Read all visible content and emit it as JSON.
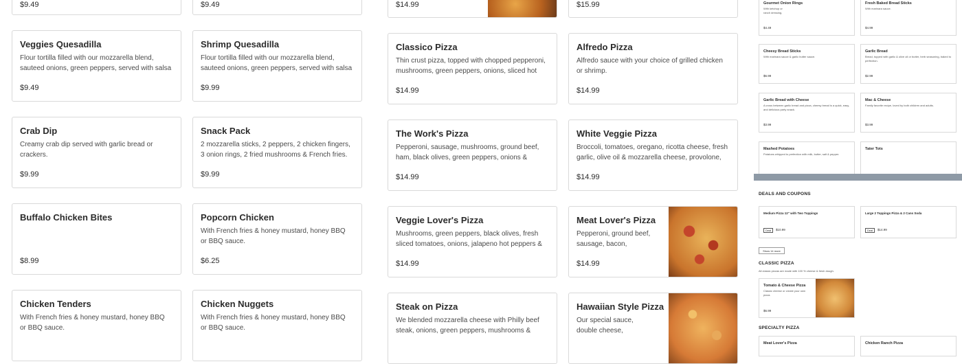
{
  "menu": {
    "top_prices": [
      "$9.49",
      "$9.49",
      "$14.99",
      "$15.99"
    ],
    "col1": [
      {
        "name": "Veggies Quesadilla",
        "desc": "Flour tortilla filled with our mozzarella blend, sauteed onions, green peppers, served with salsa",
        "price": "$9.49"
      },
      {
        "name": "Crab Dip",
        "desc": "Creamy crab dip served with garlic bread or crackers.",
        "price": "$9.99"
      },
      {
        "name": "Buffalo Chicken Bites",
        "desc": "",
        "price": "$8.99"
      },
      {
        "name": "Chicken Tenders",
        "desc": "With French fries & honey mustard, honey BBQ or BBQ sauce.",
        "price": ""
      }
    ],
    "col2": [
      {
        "name": "Shrimp Quesadilla",
        "desc": "Flour tortilla filled with our mozzarella blend, sauteed onions, green peppers, served with salsa",
        "price": "$9.99"
      },
      {
        "name": "Snack Pack",
        "desc": "2 mozzarella sticks, 2 peppers, 2 chicken fingers, 3 onion rings, 2 fried mushrooms & French fries.",
        "price": "$9.99"
      },
      {
        "name": "Popcorn Chicken",
        "desc": "With French fries & honey mustard, honey BBQ or BBQ sauce.",
        "price": "$6.25"
      },
      {
        "name": "Chicken Nuggets",
        "desc": "With French fries & honey mustard, honey BBQ or BBQ sauce.",
        "price": ""
      }
    ],
    "col3": [
      {
        "name": "Classico Pizza",
        "desc": "Thin crust pizza, topped with chopped pepperoni, mushrooms, green peppers, onions, sliced hot",
        "price": "$14.99"
      },
      {
        "name": "The Work's Pizza",
        "desc": "Pepperoni, sausage, mushrooms, ground beef, ham, black olives, green peppers, onions & double",
        "price": "$14.99"
      },
      {
        "name": "Veggie Lover's Pizza",
        "desc": "Mushrooms, green peppers, black olives, fresh sliced tomatoes, onions, jalapeno hot peppers &",
        "price": "$14.99"
      },
      {
        "name": "Steak on Pizza",
        "desc": "We blended mozzarella cheese with Philly beef steak, onions, green peppers, mushrooms &",
        "price": ""
      }
    ],
    "col4": [
      {
        "name": "Alfredo Pizza",
        "desc": "Alfredo sauce with your choice of grilled chicken or shrimp.",
        "price": "$14.99"
      },
      {
        "name": "White Veggie Pizza",
        "desc": "Broccoli, tomatoes, oregano, ricotta cheese, fresh garlic, olive oil & mozzarella cheese, provolone,",
        "price": "$14.99"
      },
      {
        "name": "Meat Lover's Pizza",
        "desc": "Pepperoni, ground beef, sausage, bacon, imported",
        "price": "$14.99"
      },
      {
        "name": "Hawaiian Style Pizza",
        "desc": "Our special sauce, double cheese, imported ham &",
        "price": ""
      }
    ]
  },
  "side": {
    "items": [
      {
        "name": "Gourmet Onion Rings",
        "desc": "With ketchup or ranch dressing.",
        "price": "$4.49"
      },
      {
        "name": "Fresh Baked Bread Sticks",
        "desc": "With marinara sauce.",
        "price": "$4.99"
      },
      {
        "name": "Cheesy Bread Sticks",
        "desc": "With marinara sauce & garlic butter sauce.",
        "price": "$6.99"
      },
      {
        "name": "Garlic Bread",
        "desc": "Bread, topped with garlic & olive oil or butter, herb seasoning, baked to perfection.",
        "price": "$2.99"
      },
      {
        "name": "Garlic Bread with Cheese",
        "desc": "A cross between garlic bread and pizza, cheesy bread is a quick, easy, and delicious party snack.",
        "price": "$3.99"
      },
      {
        "name": "Mac & Cheese",
        "desc": "Family favorite recipe, loved by both children and adults.",
        "price": "$3.99"
      },
      {
        "name": "Mashed Potatoes",
        "desc": "Potatoes whipped to perfection with milk, butter, salt & pepper.",
        "price": ""
      },
      {
        "name": "Tater Tots",
        "desc": "",
        "price": ""
      }
    ],
    "deals_heading": "DEALS AND COUPONS",
    "deals": [
      {
        "name": "Medium Pizza 12\" with Two Toppings",
        "badge": "Deal",
        "price": "$10.99"
      },
      {
        "name": "Large 2 Toppings Pizza & 2 Cans Soda",
        "badge": "Deal",
        "price": "$14.99"
      }
    ],
    "show_more": "Show 14 more",
    "classic_heading": "CLASSIC PIZZA",
    "classic_sub": "All classic pizzas are made with 100 % cheese & fresh dough.",
    "classic_item": {
      "name": "Tomato & Cheese Pizza",
      "desc": "Classic cheese or create your own pizza.",
      "price": "$6.99"
    },
    "specialty_heading": "SPECIALTY PIZZA",
    "specialty_items": [
      "Meat Lover's Pizza",
      "Chicken Ranch Pizza"
    ]
  },
  "colors": {
    "border": "#d9d9d9",
    "band": "#8e9aa6"
  }
}
